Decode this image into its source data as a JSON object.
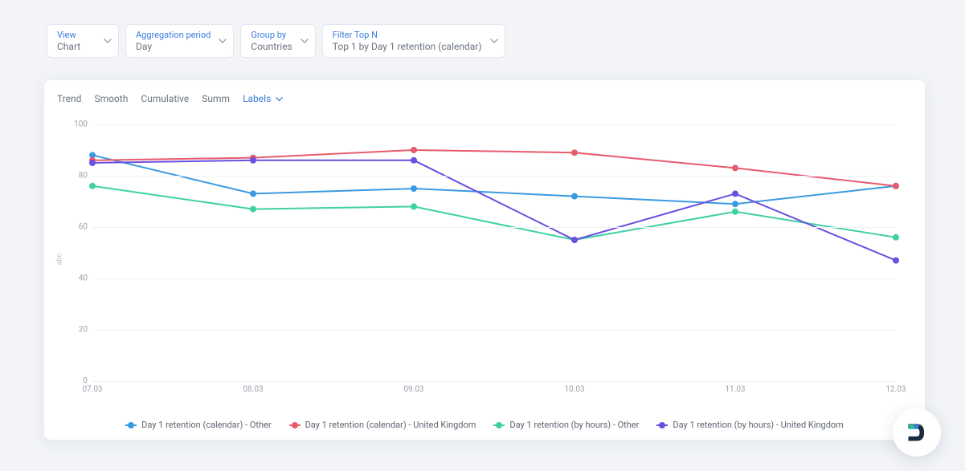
{
  "controls": {
    "view": {
      "label": "View",
      "value": "Chart"
    },
    "agg": {
      "label": "Aggregation period",
      "value": "Day"
    },
    "group": {
      "label": "Group by",
      "value": "Countries"
    },
    "filter": {
      "label": "Filter Top N",
      "value": "Top 1 by Day 1 retention (calendar)"
    }
  },
  "tabs": {
    "trend": "Trend",
    "smooth": "Smooth",
    "cumulative": "Cumulative",
    "summ": "Summ",
    "labels": "Labels"
  },
  "y_title": "abc",
  "legend": [
    {
      "label": "Day 1 retention (calendar) - Other",
      "color": "#3a9ae0"
    },
    {
      "label": "Day 1 retention (calendar) - United Kingdom",
      "color": "#e85b6e"
    },
    {
      "label": "Day 1 retention (by hours) - Other",
      "color": "#3fd0a6"
    },
    {
      "label": "Day 1 retention (by hours) - United Kingdom",
      "color": "#6b4fe0"
    }
  ],
  "chart_data": {
    "type": "line",
    "xlabel": "",
    "ylabel": "",
    "ylim": [
      0,
      100
    ],
    "y_ticks": [
      0,
      20,
      40,
      60,
      80,
      100
    ],
    "categories": [
      "07.03",
      "08.03",
      "09.03",
      "10.03",
      "11.03",
      "12.03"
    ],
    "series": [
      {
        "name": "Day 1 retention (calendar) - Other",
        "color": "#3a9ae0",
        "values": [
          88,
          73,
          75,
          72,
          69,
          76
        ]
      },
      {
        "name": "Day 1 retention (calendar) - United Kingdom",
        "color": "#e85b6e",
        "values": [
          86,
          87,
          90,
          89,
          83,
          76
        ]
      },
      {
        "name": "Day 1 retention (by hours) - Other",
        "color": "#3fd0a6",
        "values": [
          76,
          67,
          68,
          55,
          66,
          56
        ]
      },
      {
        "name": "Day 1 retention (by hours) - United Kingdom",
        "color": "#6b4fe0",
        "values": [
          85,
          86,
          86,
          55,
          73,
          47
        ]
      }
    ]
  }
}
